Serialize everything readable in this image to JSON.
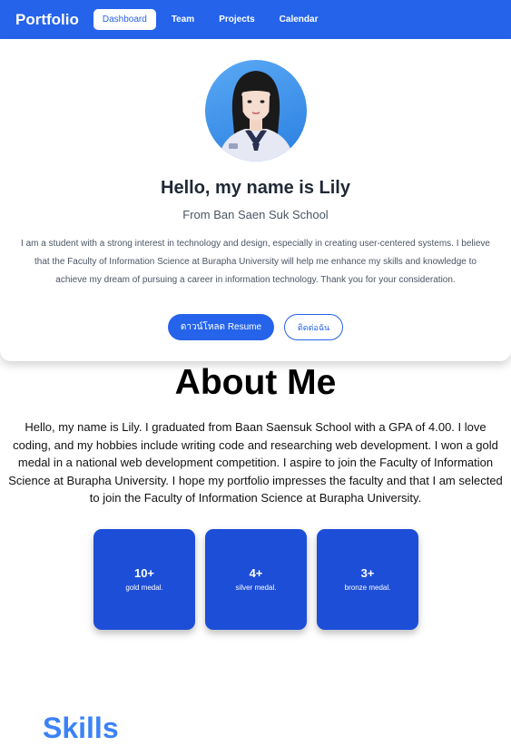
{
  "nav": {
    "brand": "Portfolio",
    "links": [
      {
        "label": "Dashboard",
        "active": true
      },
      {
        "label": "Team",
        "active": false
      },
      {
        "label": "Projects",
        "active": false
      },
      {
        "label": "Calendar",
        "active": false
      }
    ]
  },
  "hero": {
    "title": "Hello, my name is Lily",
    "subtitle": "From Ban Saen Suk School",
    "description": "I am a student with a strong interest in technology and design, especially in creating user-centered systems. I believe that the Faculty of Information Science at Burapha University will help me enhance my skills and knowledge to achieve my dream of pursuing a career in information technology. Thank you for your consideration.",
    "download_button": "ดาวน์โหลด Resume",
    "contact_button": "ติดต่อฉัน"
  },
  "about": {
    "title": "About Me",
    "text": "Hello, my name is Lily. I graduated from Baan Saensuk School with a GPA of 4.00. I love coding, and my hobbies include writing code and researching web development. I won a gold medal in a national web development competition. I aspire to join the Faculty of Information Science at Burapha University. I hope my portfolio impresses the faculty and that I am selected to join the Faculty of Information Science at Burapha University."
  },
  "stats": [
    {
      "value": "10+",
      "label": "gold medal."
    },
    {
      "value": "4+",
      "label": "silver medal."
    },
    {
      "value": "3+",
      "label": "bronze medal."
    }
  ],
  "skills": {
    "title": "Skills"
  },
  "colors": {
    "brand": "#2563eb",
    "card": "#1d4ed8",
    "skills_heading": "#3b82f6"
  }
}
